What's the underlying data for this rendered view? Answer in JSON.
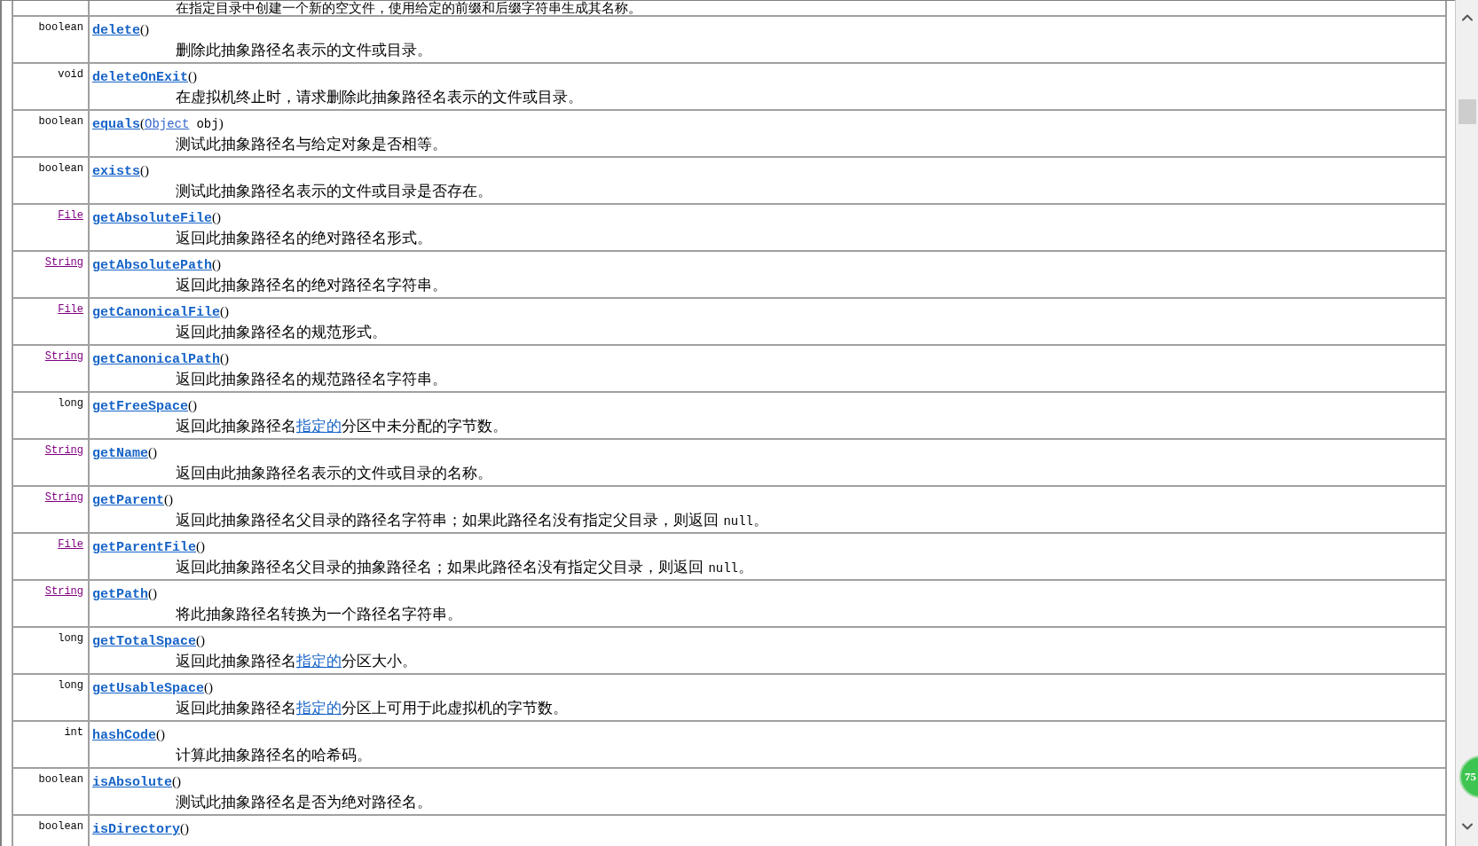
{
  "rows": [
    {
      "description": [
        {
          "text": "在指定目录中创建一个新的空文件，使用给定的前缀和后缀字符串生成其名称。"
        }
      ]
    },
    {
      "type": {
        "text": "boolean",
        "link": false
      },
      "method": "delete",
      "open": "(",
      "close": ")",
      "description": [
        {
          "text": "删除此抽象路径名表示的文件或目录。"
        }
      ]
    },
    {
      "type": {
        "text": "void",
        "link": false
      },
      "method": "deleteOnExit",
      "open": "(",
      "close": ")",
      "description": [
        {
          "text": "在虚拟机终止时，请求删除此抽象路径名表示的文件或目录。"
        }
      ]
    },
    {
      "type": {
        "text": "boolean",
        "link": false
      },
      "method": "equals",
      "open": "(",
      "close": ")",
      "param": {
        "type": "Object",
        "name": "obj"
      },
      "description": [
        {
          "text": "测试此抽象路径名与给定对象是否相等。"
        }
      ]
    },
    {
      "type": {
        "text": "boolean",
        "link": false
      },
      "method": "exists",
      "open": "(",
      "close": ")",
      "description": [
        {
          "text": "测试此抽象路径名表示的文件或目录是否存在。"
        }
      ]
    },
    {
      "type": {
        "text": "File",
        "link": true
      },
      "method": "getAbsoluteFile",
      "open": "(",
      "close": ")",
      "description": [
        {
          "text": "返回此抽象路径名的绝对路径名形式。"
        }
      ]
    },
    {
      "type": {
        "text": "String",
        "link": true
      },
      "method": "getAbsolutePath",
      "open": "(",
      "close": ")",
      "description": [
        {
          "text": "返回此抽象路径名的绝对路径名字符串。"
        }
      ]
    },
    {
      "type": {
        "text": "File",
        "link": true
      },
      "method": "getCanonicalFile",
      "open": "(",
      "close": ")",
      "description": [
        {
          "text": "返回此抽象路径名的规范形式。"
        }
      ]
    },
    {
      "type": {
        "text": "String",
        "link": true
      },
      "method": "getCanonicalPath",
      "open": "(",
      "close": ")",
      "description": [
        {
          "text": "返回此抽象路径名的规范路径名字符串。"
        }
      ]
    },
    {
      "type": {
        "text": "long",
        "link": false
      },
      "method": "getFreeSpace",
      "open": "(",
      "close": ")",
      "description": [
        {
          "text": "返回此抽象路径名"
        },
        {
          "text": "指定的",
          "link": true
        },
        {
          "text": "分区中未分配的字节数。"
        }
      ]
    },
    {
      "type": {
        "text": "String",
        "link": true
      },
      "method": "getName",
      "open": "(",
      "close": ")",
      "description": [
        {
          "text": "返回由此抽象路径名表示的文件或目录的名称。"
        }
      ]
    },
    {
      "type": {
        "text": "String",
        "link": true
      },
      "method": "getParent",
      "open": "(",
      "close": ")",
      "description": [
        {
          "text": "返回此抽象路径名父目录的路径名字符串；如果此路径名没有指定父目录，则返回 "
        },
        {
          "text": "null",
          "code": true
        },
        {
          "text": "。"
        }
      ]
    },
    {
      "type": {
        "text": "File",
        "link": true
      },
      "method": "getParentFile",
      "open": "(",
      "close": ")",
      "description": [
        {
          "text": "返回此抽象路径名父目录的抽象路径名；如果此路径名没有指定父目录，则返回 "
        },
        {
          "text": "null",
          "code": true
        },
        {
          "text": "。"
        }
      ]
    },
    {
      "type": {
        "text": "String",
        "link": true
      },
      "method": "getPath",
      "open": "(",
      "close": ")",
      "description": [
        {
          "text": "将此抽象路径名转换为一个路径名字符串。"
        }
      ]
    },
    {
      "type": {
        "text": "long",
        "link": false
      },
      "method": "getTotalSpace",
      "open": "(",
      "close": ")",
      "description": [
        {
          "text": "返回此抽象路径名"
        },
        {
          "text": "指定的",
          "link": true
        },
        {
          "text": "分区大小。"
        }
      ]
    },
    {
      "type": {
        "text": "long",
        "link": false
      },
      "method": "getUsableSpace",
      "open": "(",
      "close": ")",
      "description": [
        {
          "text": "返回此抽象路径名"
        },
        {
          "text": "指定的",
          "link": true
        },
        {
          "text": "分区上可用于此虚拟机的字节数。"
        }
      ]
    },
    {
      "type": {
        "text": "int",
        "link": false
      },
      "method": "hashCode",
      "open": "(",
      "close": ")",
      "description": [
        {
          "text": "计算此抽象路径名的哈希码。"
        }
      ]
    },
    {
      "type": {
        "text": "boolean",
        "link": false
      },
      "method": "isAbsolute",
      "open": "(",
      "close": ")",
      "description": [
        {
          "text": "测试此抽象路径名是否为绝对路径名。"
        }
      ]
    },
    {
      "type": {
        "text": "boolean",
        "link": false
      },
      "method": "isDirectory",
      "open": "(",
      "close": ")"
    }
  ],
  "badge": "75"
}
